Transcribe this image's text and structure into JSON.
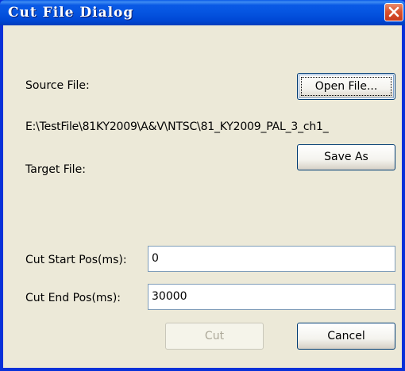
{
  "window": {
    "title": "Cut File Dialog"
  },
  "labels": {
    "source_file": "Source File:",
    "source_path": "E:\\TestFile\\81KY2009\\A&V\\NTSC\\81_KY2009_PAL_3_ch1_",
    "target_file": "Target File:",
    "cut_start": "Cut Start Pos(ms):",
    "cut_end": "Cut End Pos(ms):"
  },
  "buttons": {
    "open_file": "Open File...",
    "save_as": "Save As",
    "cut": "Cut",
    "cancel": "Cancel"
  },
  "inputs": {
    "cut_start_value": "0",
    "cut_end_value": "30000"
  },
  "colors": {
    "titlebar": "#0554e0",
    "dialog_bg": "#ece9d8",
    "close_button": "#d9522f",
    "disabled_text": "#aca899"
  },
  "icons": {
    "close": "close-x-icon"
  }
}
